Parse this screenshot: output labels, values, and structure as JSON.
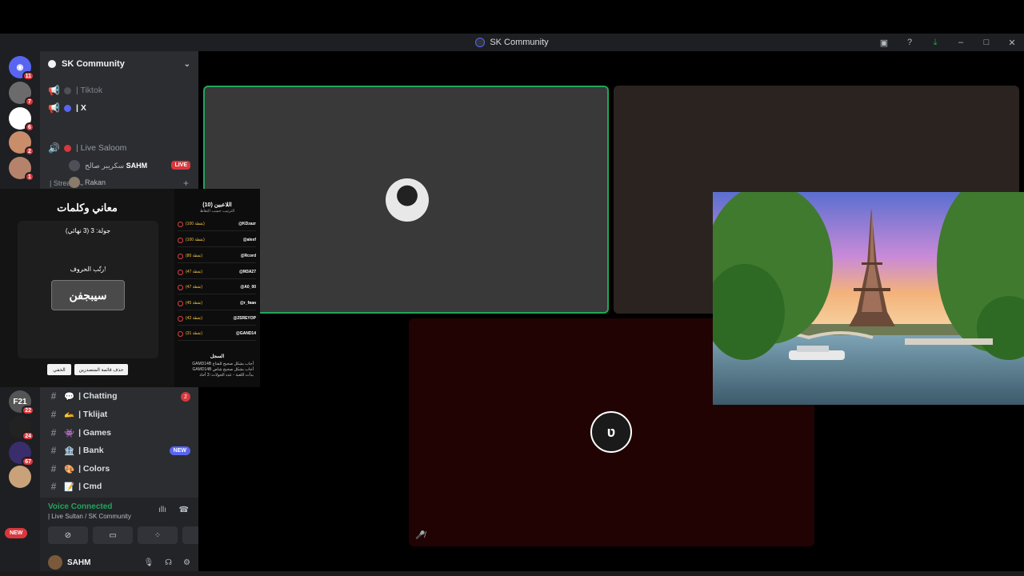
{
  "window": {
    "title": "SK Community",
    "controls": [
      "inbox-icon",
      "help-icon",
      "download-icon",
      "minimize-icon",
      "maximize-icon",
      "close-icon"
    ]
  },
  "guilds": [
    {
      "name": "discord-home",
      "badge": "11"
    },
    {
      "name": "server-2",
      "badge": "7"
    },
    {
      "name": "server-3",
      "badge": "6"
    },
    {
      "name": "server-4",
      "badge": "2"
    },
    {
      "name": "server-5",
      "badge": "1"
    },
    {
      "name": "server-f21",
      "label": "F21",
      "badge": "22"
    },
    {
      "name": "server-v",
      "badge": "24"
    },
    {
      "name": "server-8",
      "badge": "67"
    },
    {
      "name": "server-9",
      "badge": "NEW"
    }
  ],
  "server": {
    "name": "SK Community"
  },
  "channels": {
    "tiktok": "| Tiktok",
    "x": "| X",
    "category_stream": "| Stream",
    "live_saloom": "| Live Saloom",
    "live_badge": "LIVE",
    "voice_users": [
      {
        "name": "سكريبر صالح",
        "tag": "SAHM"
      },
      {
        "name": "Rakan"
      }
    ],
    "text": [
      {
        "label": "| Chatting",
        "emoji": "💬",
        "badge": "2"
      },
      {
        "label": "| Tklijat",
        "emoji": "🫴"
      },
      {
        "label": "| Games",
        "emoji": "👾"
      },
      {
        "label": "| Bank",
        "emoji": "🏦",
        "badge": "NEW"
      },
      {
        "label": "| Colors",
        "emoji": "🎨"
      },
      {
        "label": "| Cmd",
        "emoji": "📝"
      }
    ]
  },
  "voice": {
    "status": "Voice Connected",
    "location": "| Live Sultan / SK Community"
  },
  "user": {
    "name": "SAHM"
  },
  "game": {
    "title": "معاني وكلمات",
    "round": "جولة: 3 (3 نهائي)",
    "prompt": "رتّب الحروف!",
    "scrambled_word": "سيبجفن",
    "buttons": [
      "حذف قائمة المتصدرين",
      "الخفي"
    ],
    "leaderboard_title": "اللاعبين (10)",
    "leaderboard_sub": "الترتيب حسب النقاط",
    "leaderboard": [
      {
        "name": "@KDzazr",
        "points": "(100 نقطة)"
      },
      {
        "name": "@alexf",
        "points": "(100 نقطة)"
      },
      {
        "name": "@Rcord",
        "points": "(80 نقطة)"
      },
      {
        "name": "@M3A27",
        "points": "(47 نقطة)"
      },
      {
        "name": "@A0_00",
        "points": "(47 نقطة)"
      },
      {
        "name": "@r_fван",
        "points": "(45 نقطة)"
      },
      {
        "name": "@2SREYOP",
        "points": "(42 نقطة)"
      },
      {
        "name": "@GAND14",
        "points": "(31 نقطة)"
      }
    ],
    "log_title": "السجل",
    "log": [
      "GAMD14B أجاب بشكل صحيح للفتاح",
      "GAMD14B أجاب بشكل صحيح شاص",
      "بدأت اللعبة - عدد الجولات: 3 أحاد"
    ]
  },
  "colors": {
    "speaking_border": "#23a55a",
    "live_red": "#da373c",
    "blurple": "#5865f2",
    "tile_gray": "#393939",
    "tile_brown": "#2b231f",
    "tile_maroon": "#210303"
  }
}
